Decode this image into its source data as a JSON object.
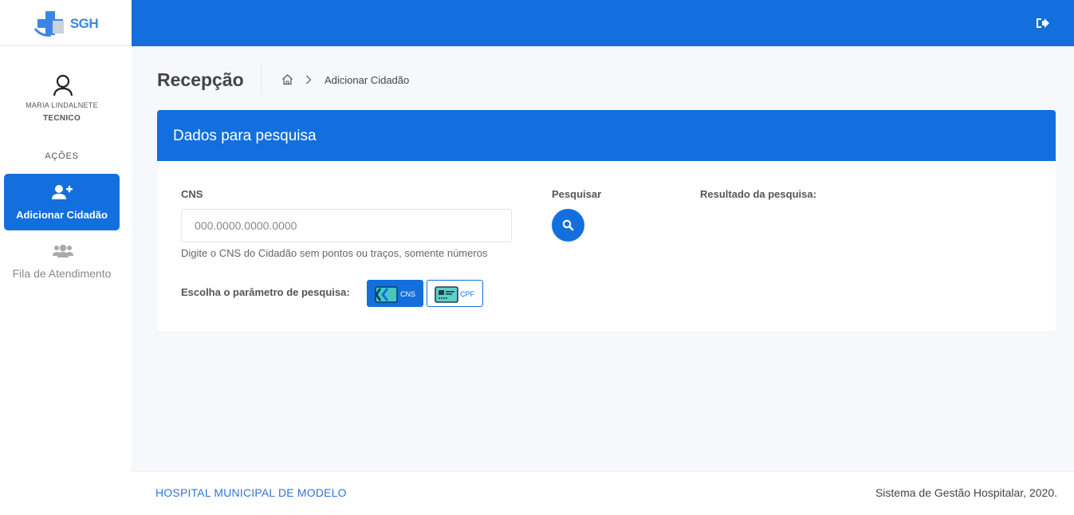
{
  "brand": {
    "logo_text": "SGH",
    "primary_color": "#136fdd"
  },
  "topbar": {
    "logout_icon": "sign-out-icon"
  },
  "sidebar": {
    "user_name": "MARIA LINDALNETE",
    "user_role": "TECNICO",
    "section_title": "AÇÕES",
    "items": [
      {
        "label": "Adicionar Cidadão",
        "icon": "user-plus-icon",
        "active": true
      },
      {
        "label": "Fila de Atendimento",
        "icon": "users-icon",
        "active": false
      }
    ]
  },
  "page": {
    "title": "Recepção",
    "breadcrumb": {
      "home_icon": "home-icon",
      "current": "Adicionar Cidadão"
    }
  },
  "card": {
    "title": "Dados para pesquisa",
    "cns_label": "CNS",
    "cns_placeholder": "000.0000.0000.0000",
    "cns_value": "",
    "cns_help": "Digite o CNS do Cidadão sem pontos ou traços, somente números",
    "search_label": "Pesquisar",
    "result_label": "Resultado da pesquisa:",
    "param_label": "Escolha o parâmetro de pesquisa:",
    "params": [
      {
        "label": "CNS",
        "icon": "cns-card-icon",
        "selected": true
      },
      {
        "label": "CPF",
        "icon": "cpf-card-icon",
        "selected": false
      }
    ]
  },
  "footer": {
    "left": "HOSPITAL MUNICIPAL DE MODELO",
    "right": "Sistema de Gestão Hospitalar, 2020."
  }
}
